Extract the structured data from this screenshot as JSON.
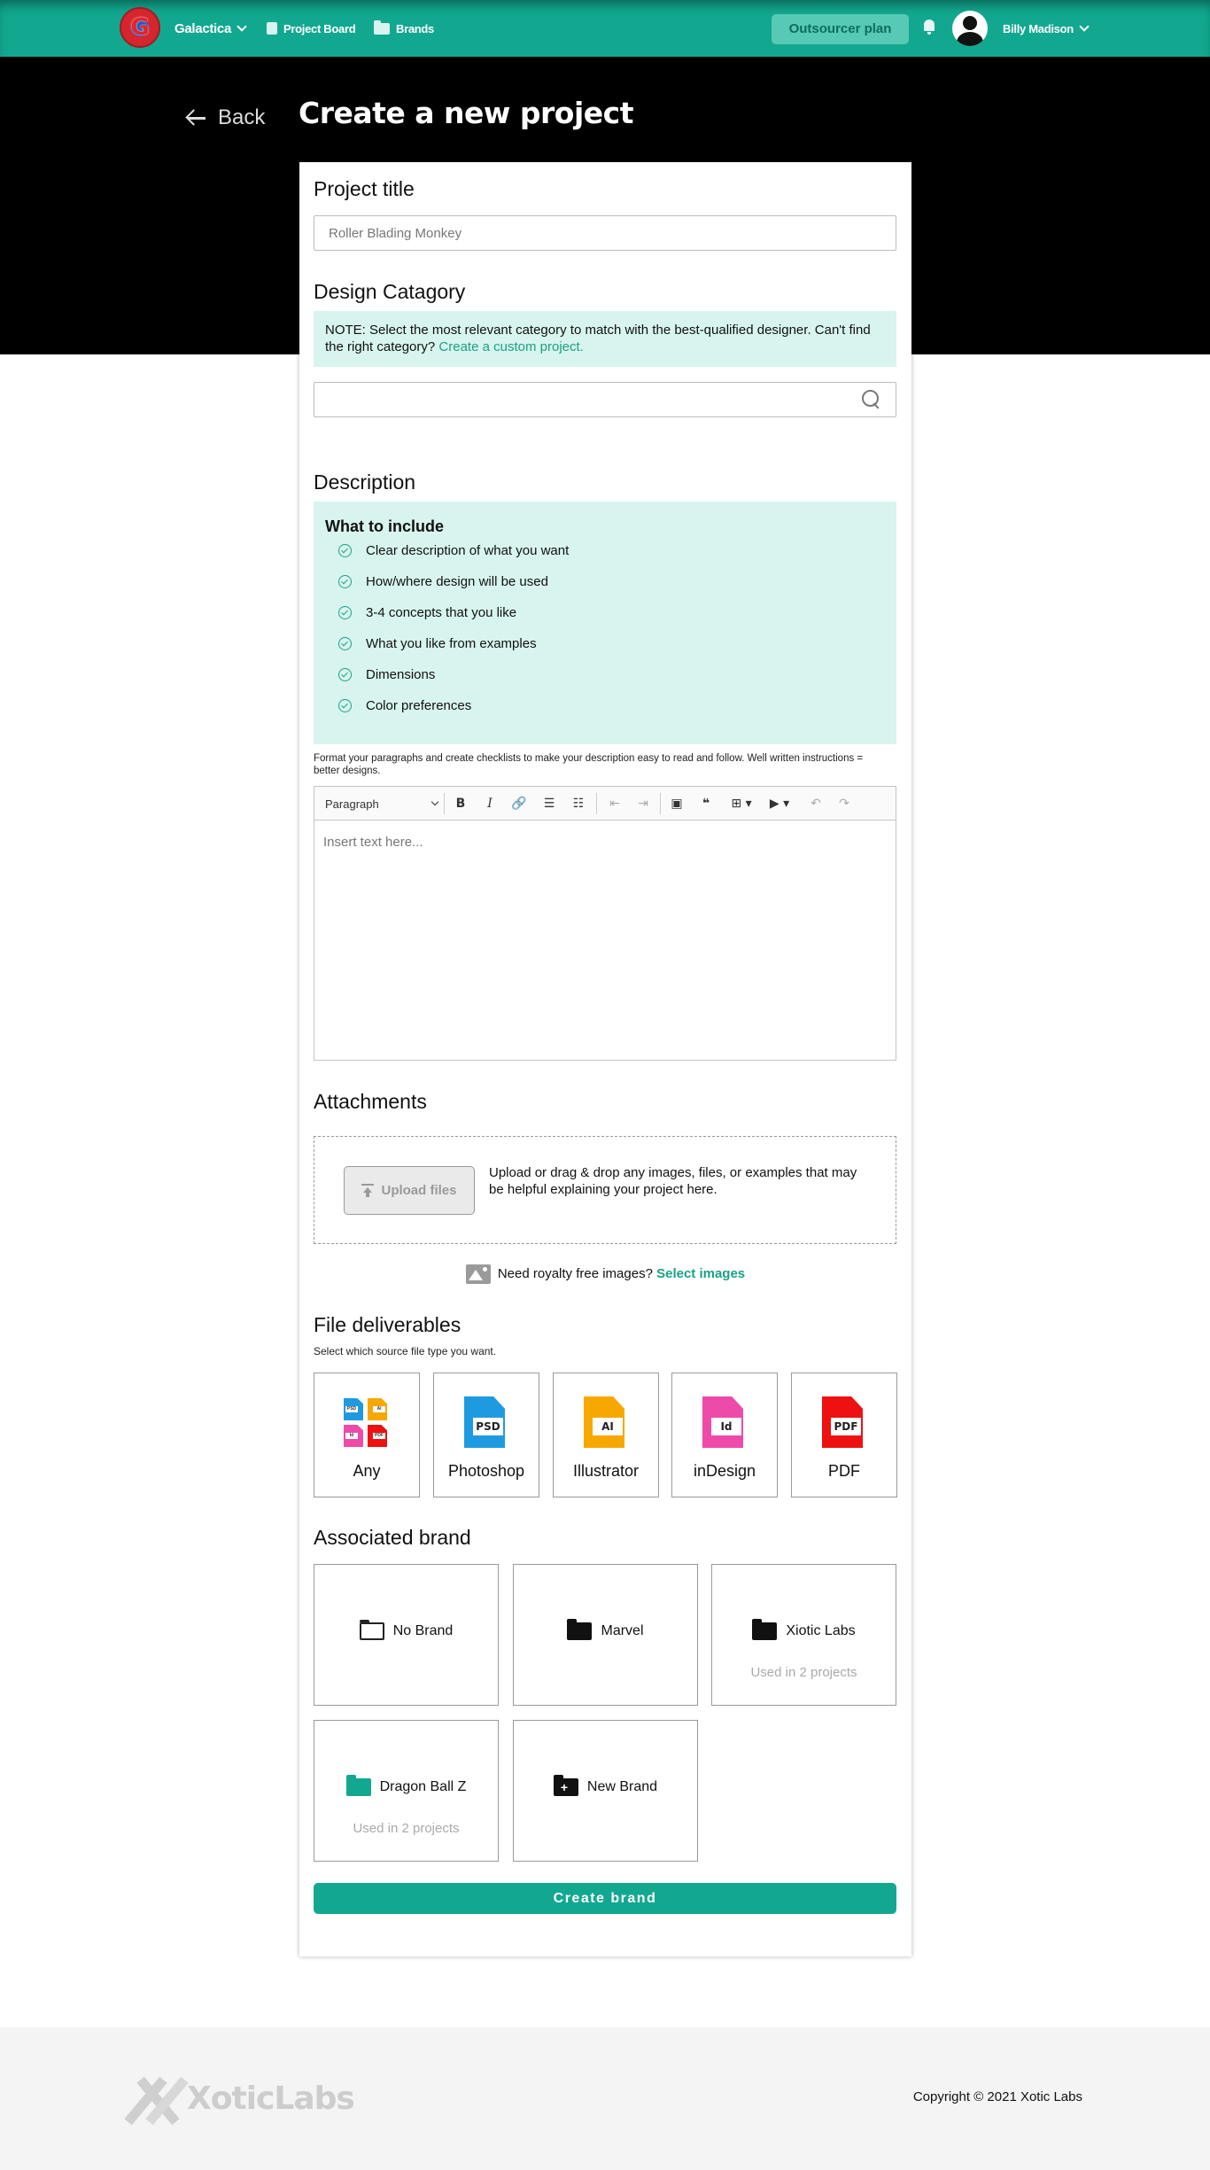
{
  "nav": {
    "brand": "Galactica",
    "logo_letter": "G",
    "project_board": "Project Board",
    "brands": "Brands",
    "plan_button": "Outsourcer plan",
    "user_name": "Billy Madison"
  },
  "header": {
    "back_label": "Back",
    "title": "Create a new project"
  },
  "form": {
    "project_title": {
      "label": "Project title",
      "placeholder": "Roller Blading Monkey"
    },
    "category": {
      "label": "Design Catagory",
      "note": "NOTE: Select the most relevant category to match with the best-qualified designer. Can't find the right category? ",
      "note_link": "Create a custom project.",
      "search_value": ""
    },
    "description": {
      "label": "Description",
      "include_title": "What to include",
      "include_items": [
        "Clear description of what you want",
        "How/where design will be used",
        "3-4 concepts that you like",
        "What you like from examples",
        "Dimensions",
        "Color preferences"
      ],
      "hint": "Format your paragraphs and create checklists to make your description easy to read and follow. Well written instructions = better designs.",
      "paragraph_select": "Paragraph",
      "editor_placeholder": "Insert text here...",
      "toolbar_icons": [
        "bold-icon",
        "italic-icon",
        "link-icon",
        "bulleted-list-icon",
        "numbered-list-icon",
        "outdent-icon",
        "indent-icon",
        "image-icon",
        "quote-icon",
        "table-icon",
        "media-icon",
        "undo-icon",
        "redo-icon"
      ]
    },
    "attachments": {
      "label": "Attachments",
      "upload_button": "Upload files",
      "help_text": "Upload or drag & drop any images, files, or examples that may be helpful explaining your project here.",
      "royalty_text": "Need royalty free images? ",
      "royalty_link": "Select images"
    },
    "deliverables": {
      "label": "File deliverables",
      "subtitle": "Select which source file type you want.",
      "options": [
        {
          "label": "Any",
          "icon": "any-files-icon"
        },
        {
          "label": "Photoshop",
          "tag": "PSD",
          "color": "#1e9be0"
        },
        {
          "label": "Illustrator",
          "tag": "AI",
          "color": "#f7a800"
        },
        {
          "label": "inDesign",
          "tag": "Id",
          "color": "#ee4aaa"
        },
        {
          "label": "PDF",
          "tag": "PDF",
          "color": "#ee1111"
        }
      ],
      "any_tags": [
        "PSD",
        "AI",
        "Id",
        "PDF"
      ]
    },
    "brand": {
      "label": "Associated brand",
      "options": [
        {
          "name": "No Brand",
          "used": "",
          "icon": "folder-open-icon"
        },
        {
          "name": "Marvel",
          "used": "",
          "icon": "folder-icon"
        },
        {
          "name": "Xiotic Labs",
          "used": "Used in 2 projects",
          "icon": "folder-icon"
        },
        {
          "name": "Dragon Ball Z",
          "used": "Used in 2 projects",
          "icon": "folder-icon",
          "color": "#12a890"
        },
        {
          "name": "New Brand",
          "used": "",
          "icon": "folder-plus-icon"
        }
      ],
      "create_button": "Create brand"
    }
  },
  "footer": {
    "logo_text": "XoticLabs",
    "copyright": "Copyright © 2021 Xotic Labs"
  },
  "colors": {
    "primary": "#12a890",
    "hero": "#000000",
    "note_bg": "#d8f4ee",
    "link": "#1aa187"
  }
}
